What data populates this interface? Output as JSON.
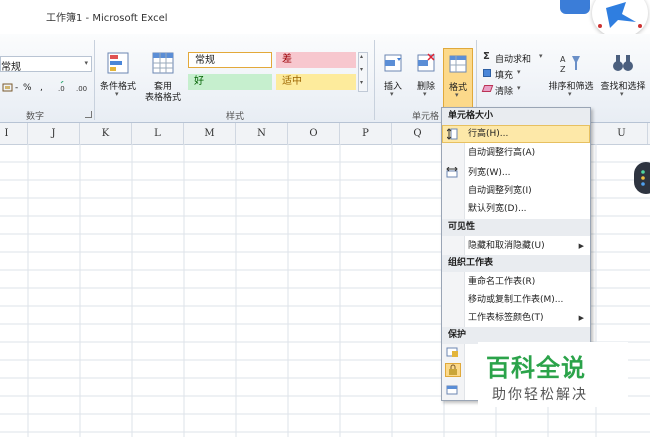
{
  "window": {
    "title": "工作簿1 - Microsoft Excel"
  },
  "ribbon": {
    "number_format_value": "常规",
    "number_format_btns": [
      "-",
      "%",
      ","
    ],
    "group_number": "数字",
    "group_styles": "样式",
    "group_cells": "单元格",
    "conditional_format": "条件格式",
    "table_format_line1": "套用",
    "table_format_line2": "表格格式",
    "style_normal": "常规",
    "style_bad": "差",
    "style_good": "好",
    "style_neutral": "适中",
    "insert": "插入",
    "delete": "删除",
    "format": "格式",
    "autosum": "自动求和",
    "fill": "填充",
    "clear": "清除",
    "sort_filter": "排序和筛选",
    "find_select": "查找和选择",
    "arrow": "▾"
  },
  "columns": [
    "I",
    "J",
    "K",
    "L",
    "M",
    "N",
    "O",
    "P",
    "Q",
    "U"
  ],
  "menu": {
    "sec_cell_size": "单元格大小",
    "row_height": "行高(H)...",
    "autofit_row": "自动调整行高(A)",
    "col_width": "列宽(W)...",
    "autofit_col": "自动调整列宽(I)",
    "default_width": "默认列宽(D)...",
    "sec_visibility": "可见性",
    "hide_unhide": "隐藏和取消隐藏(U)",
    "sec_organize": "组织工作表",
    "rename_sheet": "重命名工作表(R)",
    "move_copy": "移动或复制工作表(M)...",
    "tab_color": "工作表标签颜色(T)",
    "sec_protect": "保护",
    "submenu_arrow": "▶"
  },
  "watermark": {
    "title": "百科全说",
    "subtitle": "助你轻松解决"
  },
  "colors": {
    "accent": "#2ba34a",
    "highlight": "#fde8a8",
    "bad_bg": "#f7c7ce",
    "good_bg": "#c6efce",
    "neutral_bg": "#fdeb9c"
  }
}
